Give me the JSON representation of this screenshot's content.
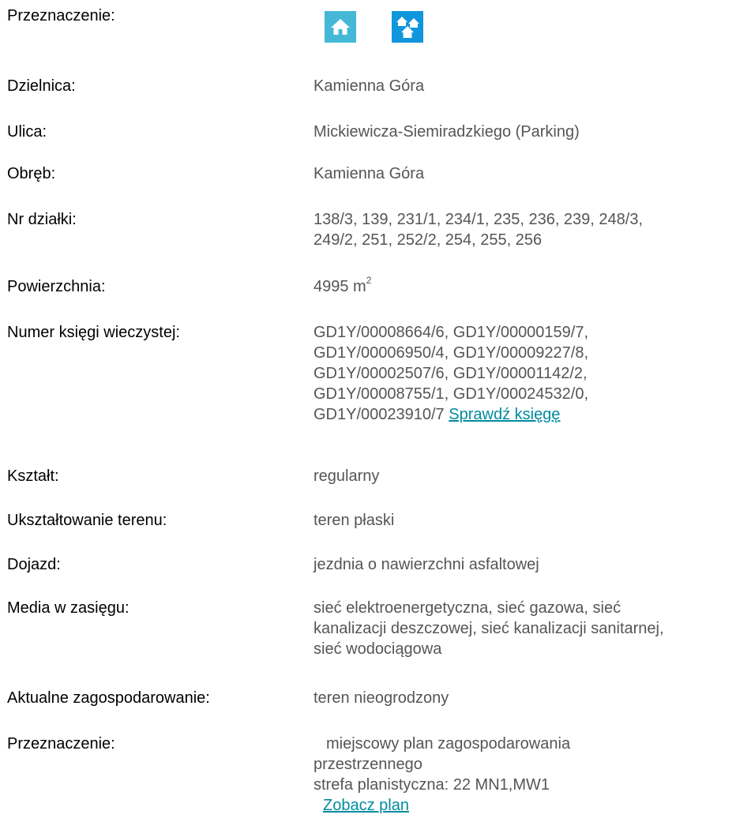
{
  "icons": {
    "single_house": {
      "name": "single-family-house-icon",
      "color": "#45b8d8"
    },
    "multi_house": {
      "name": "multi-family-houses-icon",
      "color": "#0f96dc"
    }
  },
  "rows": {
    "przeznaczenie_top": {
      "label": "Przeznaczenie:"
    },
    "dzielnica": {
      "label": "Dzielnica:",
      "value": "Kamienna Góra"
    },
    "ulica": {
      "label": "Ulica:",
      "value": "Mickiewicza-Siemiradzkiego (Parking)"
    },
    "obreb": {
      "label": "Obręb:",
      "value": "Kamienna Góra"
    },
    "nr_dzialki": {
      "label": "Nr działki:",
      "lines": [
        "138/3, 139, 231/1, 234/1, 235, 236, 239, 248/3,",
        "249/2, 251, 252/2, 254, 255, 256"
      ]
    },
    "powierzchnia": {
      "label": "Powierzchnia:",
      "value": "4995 m",
      "unit_sup": "2"
    },
    "ksiega": {
      "label": "Numer księgi wieczystej:",
      "lines": [
        "GD1Y/00008664/6, GD1Y/00000159/7,",
        "GD1Y/00006950/4, GD1Y/00009227/8,",
        "GD1Y/00002507/6, GD1Y/00001142/2,",
        "GD1Y/00008755/1, GD1Y/00024532/0,",
        "GD1Y/00023910/7"
      ],
      "link": "Sprawdź księgę"
    },
    "ksztalt": {
      "label": "Kształt:",
      "value": "regularny"
    },
    "uksztaltowanie": {
      "label": "Ukształtowanie terenu:",
      "value": "teren płaski"
    },
    "dojazd": {
      "label": "Dojazd:",
      "value": "jezdnia o nawierzchni asfaltowej"
    },
    "media": {
      "label": "Media w zasięgu:",
      "lines": [
        "sieć elektroenergetyczna, sieć gazowa, sieć",
        "kanalizacji deszczowej, sieć kanalizacji sanitarnej,",
        "sieć wodociągowa"
      ]
    },
    "zagospodarowanie": {
      "label": "Aktualne zagospodarowanie:",
      "value": "teren nieogrodzony"
    },
    "przeznaczenie_plan": {
      "label": "Przeznaczenie:",
      "lines": [
        "miejscowy plan zagospodarowania",
        "przestrzennego",
        "strefa planistyczna: 22 MN1,MW1"
      ],
      "link": "Zobacz plan"
    }
  }
}
